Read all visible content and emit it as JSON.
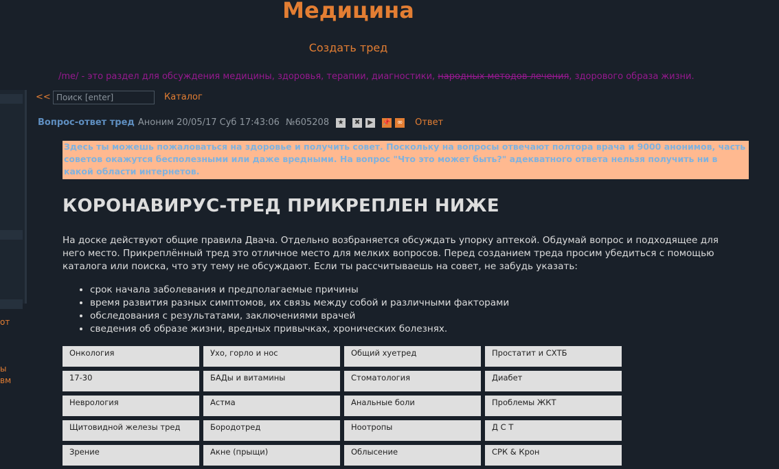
{
  "board": {
    "title": "Медицина",
    "create_thread": "Создать тред",
    "desc_part1": "/me/ - это раздел для обсуждения медицины, здоровья, терапии, диагностики, ",
    "desc_strike": "народных методов лечения",
    "desc_part2": ", здорового образа жизни."
  },
  "sidebar_fragments": [
    "от",
    "ы",
    "вм"
  ],
  "nav": {
    "back": "<<",
    "search_placeholder": "Поиск [enter]",
    "catalog": "Каталог"
  },
  "post": {
    "subject": "Вопрос-ответ тред",
    "meta": "Аноним 20/05/17 Суб 17:43:06",
    "number": "№605208",
    "icons": {
      "favorite": "★",
      "hide": "✖",
      "play": "▶",
      "pin": "📌",
      "infinity": "∞"
    },
    "reply": "Ответ",
    "warning": "Здесь ты можешь пожаловаться на здоровье и получить совет. Поскольку на вопросы отвечают полтора врача и 9000 анонимов, часть советов окажутся бесполезными или даже вредными. На вопрос \"Что это может быть?\" адекватного ответа нельзя получить ни в какой области интернетов.",
    "heading": "КОРОНАВИРУС-ТРЕД ПРИКРЕПЛЕН НИЖЕ",
    "intro": "На доске действуют общие правила Двача. Отдельно возбраняется обсуждать упорку аптекой. Обдумай вопрос и подходящее для него место. Прикреплённый тред это отличное место для мелких вопросов. Перед созданием треда просим убедиться с помощью каталога или поиска, что эту тему не обсуждают. Если ты рассчитываешь на совет, не забудь указать:",
    "requirements": [
      "срок начала заболевания и предполагаемые причины",
      "время развития разных симптомов, их связь между собой и различными факторами",
      "обследования с результатами, заключениями врачей",
      "сведения об образе жизни, вредных привычках, хронических болезнях."
    ],
    "topics": [
      "Онкология",
      "Ухо, горло и нос",
      "Общий хуетред",
      "Простатит и СХТБ",
      "17-30",
      "БАДы и витамины",
      "Стоматология",
      "Диабет",
      "Неврология",
      "Астма",
      "Анальные боли",
      "Проблемы ЖКТ",
      "Щитовидной железы тред",
      "Бородотред",
      "Ноотропы",
      "Д С Т",
      "Зрение",
      "Акне (прыщи)",
      "Облысение",
      "СРК & Крон"
    ]
  },
  "colors": {
    "background": "#192029",
    "accent": "#e37e33",
    "subject": "#5f8fc1",
    "description": "#96198f",
    "warning_bg": "#ffb990",
    "warning_text": "#7fb2df",
    "topic_bg": "#dfdfdf"
  }
}
